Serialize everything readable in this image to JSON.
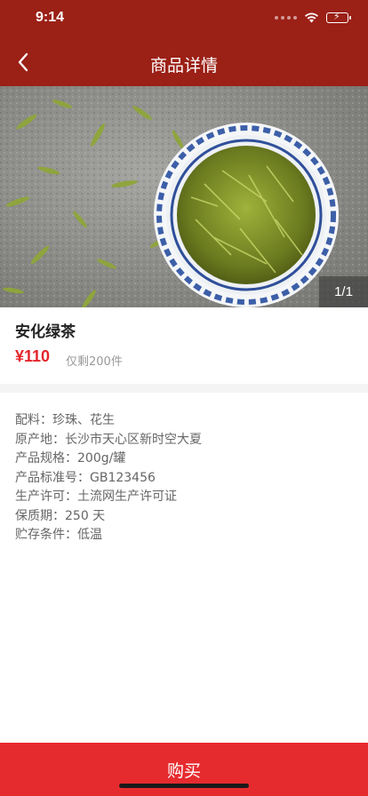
{
  "status_bar": {
    "time": "9:14"
  },
  "nav": {
    "title": "商品详情"
  },
  "gallery": {
    "counter": "1/1",
    "image_description_icon": "tea-photo"
  },
  "product": {
    "name": "安化绿茶",
    "price": "¥110",
    "stock": "仅剩200件"
  },
  "specs": [
    {
      "label": "配料：珍珠、花生"
    },
    {
      "label": "原产地：长沙市天心区新时空大夏"
    },
    {
      "label": "产品规格：200g/罐"
    },
    {
      "label": "产品标准号：GB123456"
    },
    {
      "label": "生产许可：土流网生产许可证"
    },
    {
      "label": "保质期：250 天"
    },
    {
      "label": "贮存条件：低温"
    }
  ],
  "footer": {
    "buy_label": "购买"
  },
  "colors": {
    "header": "#9b2016",
    "price": "#e4262c",
    "buy_button": "#e62b2f"
  }
}
